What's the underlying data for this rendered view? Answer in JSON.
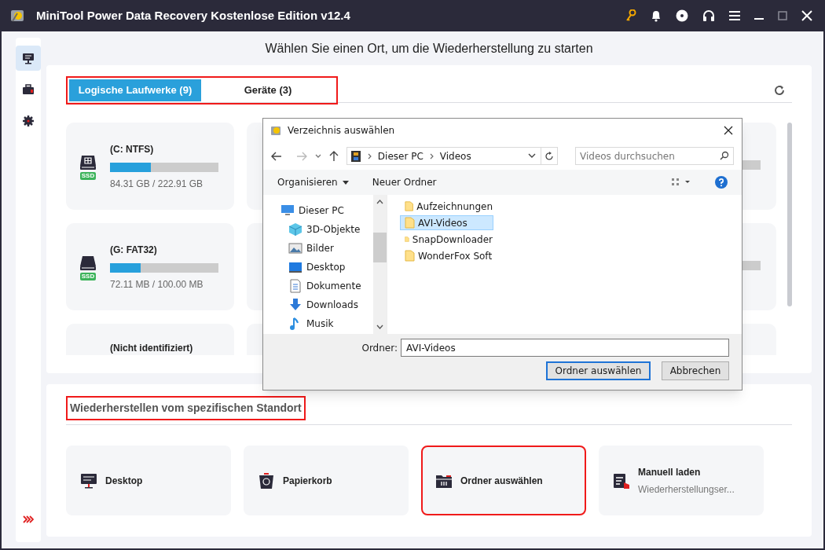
{
  "window": {
    "title": "MiniTool Power Data Recovery Kostenlose Edition v12.4"
  },
  "sidebar": {
    "items": [
      {
        "selected": true
      },
      {
        "selected": false
      },
      {
        "selected": false
      }
    ]
  },
  "heading": "Wählen Sie einen Ort, um die Wiederherstellung zu starten",
  "tabs_highlighted": true,
  "tabs": [
    {
      "label": "Logische Laufwerke (9)",
      "selected": true
    },
    {
      "label": "Geräte (3)",
      "selected": false
    }
  ],
  "drives": [
    {
      "name": "(C: NTFS)",
      "kind": "windows",
      "badge": "SSD",
      "level": 0.38,
      "usage": "84.31 GB / 222.91 GB"
    },
    {
      "name": "(G: FAT32)",
      "kind": "disk",
      "badge": "SSD",
      "level": 0.28,
      "usage": "72.11 MB / 100.00 MB"
    },
    {
      "name": "(Nicht identifiziert)",
      "kind": "unknown"
    }
  ],
  "section": {
    "title": "Wiederherstellen vom spezifischen Standort",
    "highlighted": true
  },
  "locations": [
    {
      "kind": "desktop",
      "label": "Desktop",
      "highlighted": false
    },
    {
      "kind": "trash",
      "label": "Papierkorb",
      "highlighted": false
    },
    {
      "kind": "folder",
      "label": "Ordner auswählen",
      "highlighted": true
    },
    {
      "kind": "load",
      "label": "Manuell laden",
      "subtitle": "Wiederherstellungser...",
      "highlighted": false
    }
  ],
  "dialog": {
    "title": "Verzeichnis auswählen",
    "path": [
      "Dieser PC",
      "Videos"
    ],
    "search_placeholder": "Videos durchsuchen",
    "organize": "Organisieren",
    "new_folder": "Neuer Ordner",
    "tree": [
      {
        "label": "Dieser PC",
        "kind": "pc",
        "children": [
          {
            "label": "3D-Objekte",
            "kind": "cube"
          },
          {
            "label": "Bilder",
            "kind": "pictures"
          },
          {
            "label": "Desktop",
            "kind": "desktop"
          },
          {
            "label": "Dokumente",
            "kind": "documents"
          },
          {
            "label": "Downloads",
            "kind": "downloads"
          },
          {
            "label": "Musik",
            "kind": "music"
          }
        ]
      }
    ],
    "files": [
      {
        "name": "Aufzeichnungen",
        "selected": false
      },
      {
        "name": "AVI-Videos",
        "selected": true
      },
      {
        "name": "SnapDownloader",
        "selected": false
      },
      {
        "name": "WonderFox Soft",
        "selected": false
      }
    ],
    "folder_label": "Ordner:",
    "folder_value": "AVI-Videos",
    "buttons": [
      {
        "label": "Ordner auswählen",
        "kind": "default"
      },
      {
        "label": "Abbrechen",
        "kind": "normal"
      }
    ]
  }
}
